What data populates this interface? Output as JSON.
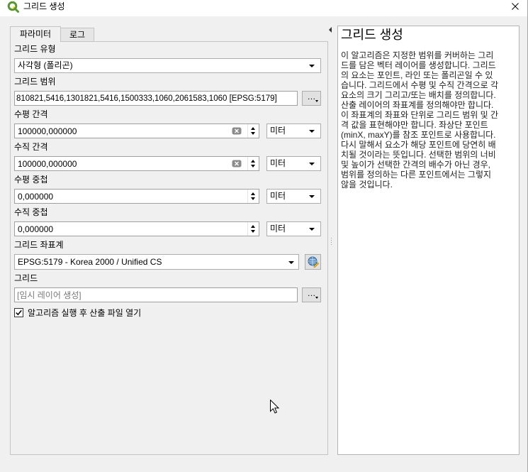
{
  "window": {
    "title": "그리드 생성"
  },
  "icons": {
    "app": "qgis-logo-icon",
    "close": "close-icon",
    "collapse": "collapse-left-icon",
    "clear": "clear-value-icon",
    "crs": "set-projection-icon",
    "cursor": "mouse-pointer-icon"
  },
  "colors": {
    "dialog_bg": "#f0f0f0",
    "help_bg": "#ffffff",
    "border": "#adadad",
    "placeholder": "#7a7a7a",
    "qgis_green": "#589632",
    "qgis_yellow": "#f0e64a"
  },
  "tabs": [
    {
      "label": "파라미터",
      "active": true
    },
    {
      "label": "로그",
      "active": false
    }
  ],
  "params": {
    "grid_type": {
      "label": "그리드 유형",
      "value": "사각형 (폴리곤)"
    },
    "grid_extent": {
      "label": "그리드 범위",
      "value": "810821,5416,1301821,5416,1500333,1060,2061583,1060 [EPSG:5179]",
      "button": "…"
    },
    "h_spacing": {
      "label": "수평 간격",
      "value": "100000,000000",
      "unit": "미터"
    },
    "v_spacing": {
      "label": "수직 간격",
      "value": "100000,000000",
      "unit": "미터"
    },
    "h_overlay": {
      "label": "수평 중첩",
      "value": "0,000000",
      "unit": "미터"
    },
    "v_overlay": {
      "label": "수직 중첩",
      "value": "0,000000",
      "unit": "미터"
    },
    "grid_crs": {
      "label": "그리드 좌표계",
      "value": "EPSG:5179 - Korea 2000 / Unified CS"
    },
    "grid_output": {
      "label": "그리드",
      "placeholder": "[임시 레이어 생성]",
      "button": "…"
    },
    "open_output": {
      "label": "알고리즘 실행 후 산출 파일 열기",
      "checked": true
    }
  },
  "help": {
    "title": "그리드 생성",
    "lines": [
      "이 알고리즘은 지정한 범위를 커버하는 그리",
      "드를 담은 벡터 레이어를 생성합니다. 그리드",
      "의 요소는 포인트, 라인 또는 폴리곤일 수 있",
      "습니다. 그리드에서 수평 및 수직 간격으로 각",
      "요소의 크기 그리고/또는 배치를 정의합니다.",
      "산출 레이어의 좌표계를 정의해야만 합니다.",
      "이 좌표계의 좌표와 단위로 그리드 범위 및 간",
      "격 값을 표현해야만 합니다. 좌상단 포인트",
      "(minX, maxY)를 참조 포인트로 사용합니다.",
      "다시 말해서 요소가 해당 포인트에 당연히 배",
      "치될 것이라는 뜻입니다. 선택한 범위의 너비",
      "및 높이가 선택한 간격의 배수가 아닌 경우,",
      "범위를 정의하는 다른 포인트에서는 그렇지",
      "않을 것입니다."
    ]
  }
}
